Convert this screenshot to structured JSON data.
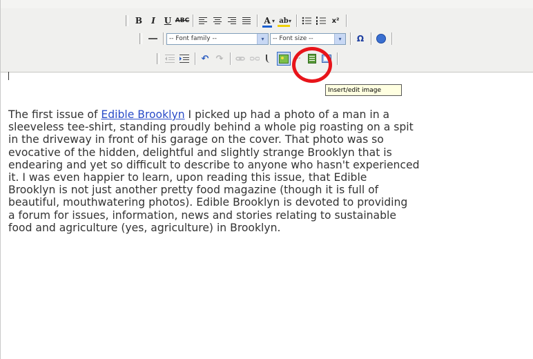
{
  "toolbar": {
    "row1": {
      "bold": "B",
      "italic": "I",
      "underline": "U",
      "strikethrough": "ABC",
      "text_color": "A",
      "bg_color": "ab",
      "dropdown_arrow": "▾",
      "superscript": "x²"
    },
    "row2": {
      "font_family_value": "-- Font family --",
      "font_size_value": "-- Font size --",
      "omega": "Ω",
      "select_arrow": "▾"
    },
    "row3": {
      "undo": "↶",
      "redo": "↷"
    }
  },
  "tooltip": {
    "text": "Insert/edit image"
  },
  "content": {
    "paragraph_lines": [
      {
        "before": "The first issue of ",
        "link": "Edible Brooklyn",
        "after": " I picked up had a photo of a man in a"
      },
      {
        "text": "sleeveless tee-shirt, standing proudly behind a whole pig roasting on a spit"
      },
      {
        "text": "in the driveway in front of his garage on the cover. That photo was so"
      },
      {
        "text": "evocative of the hidden, delightful and slightly strange Brooklyn that is"
      },
      {
        "text": "endearing and yet so difficult to describe to anyone who hasn't experienced"
      },
      {
        "text": "it. I was even happier to learn, upon reading this issue, that Edible"
      },
      {
        "text": "Brooklyn is not just another pretty food magazine (though it is full of"
      },
      {
        "text": "beautiful, mouthwatering photos). Edible Brooklyn is devoted to providing"
      },
      {
        "text": "a forum for issues, information, news and stories relating to sustainable"
      },
      {
        "text": "food and agriculture (yes, agriculture) in Brooklyn."
      }
    ]
  },
  "colors": {
    "highlight_circle": "#e8141a",
    "link": "#2a4cc8",
    "tooltip_bg": "#ffffe1",
    "toolbar_bg": "#f0f0ee"
  }
}
